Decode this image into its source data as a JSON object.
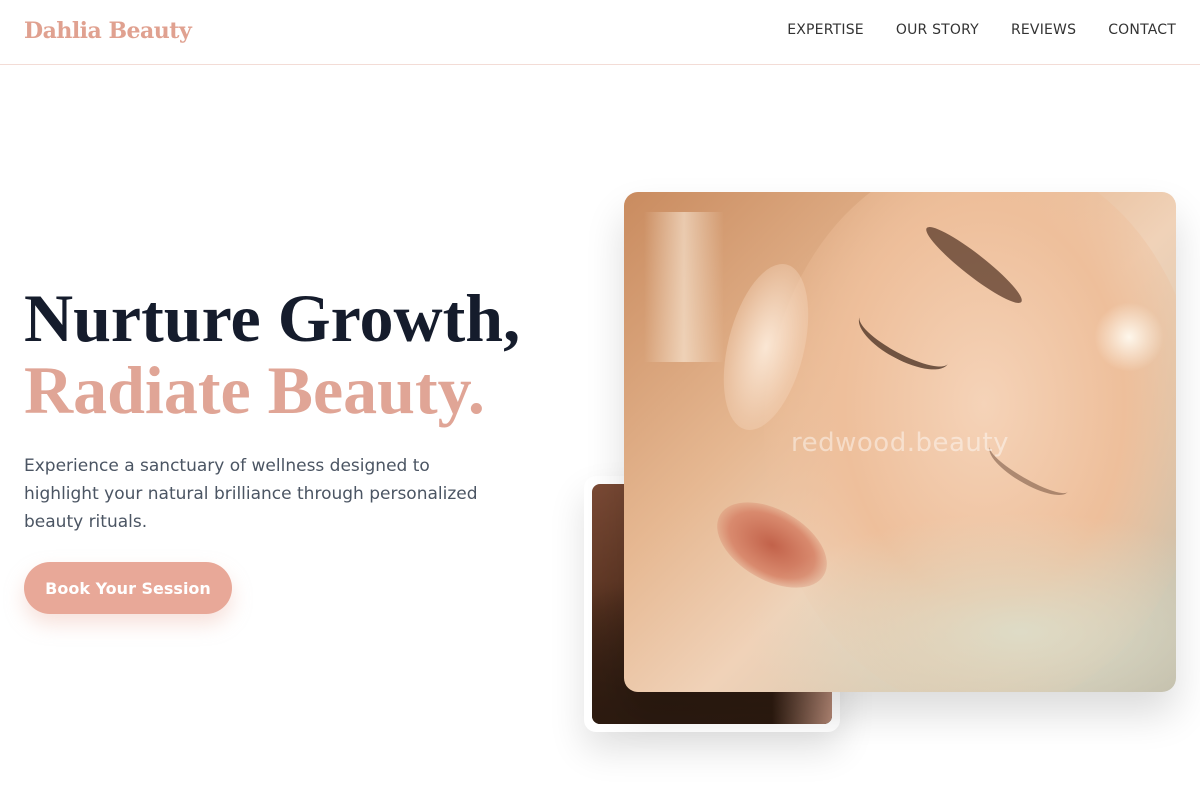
{
  "header": {
    "logo": "Dahlia Beauty",
    "nav": [
      "EXPERTISE",
      "OUR STORY",
      "REVIEWS",
      "CONTACT"
    ]
  },
  "hero": {
    "headline_line1": "Nurture Growth,",
    "headline_line2": "Radiate Beauty.",
    "subtext": "Experience a sanctuary of wellness designed to highlight your natural brilliance through personalized beauty rituals.",
    "cta_label": "Book Your Session"
  },
  "images": {
    "main_watermark": "redwood.beauty"
  },
  "colors": {
    "accent": "#e0a596",
    "button": "#e8a898",
    "heading": "#151c2c",
    "body_text": "#4b5563"
  }
}
